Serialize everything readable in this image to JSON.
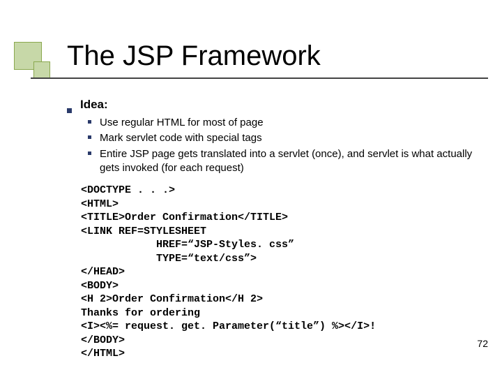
{
  "title": "The JSP Framework",
  "idea_label": "Idea:",
  "points": {
    "p1": "Use regular HTML for most of page",
    "p2": "Mark servlet code with special tags",
    "p3": "Entire JSP page gets translated into a servlet (once), and servlet is what actually gets invoked (for each request)"
  },
  "code": "<DOCTYPE . . .>\n<HTML>\n<TITLE>Order Confirmation</TITLE>\n<LINK REF=STYLESHEET\n            HREF=“JSP-Styles. css”\n            TYPE=“text/css”>\n</HEAD>\n<BODY>\n<H 2>Order Confirmation</H 2>\nThanks for ordering\n<I><%= request. get. Parameter(“title”) %></I>!\n</BODY>\n</HTML>",
  "page_number": "72"
}
